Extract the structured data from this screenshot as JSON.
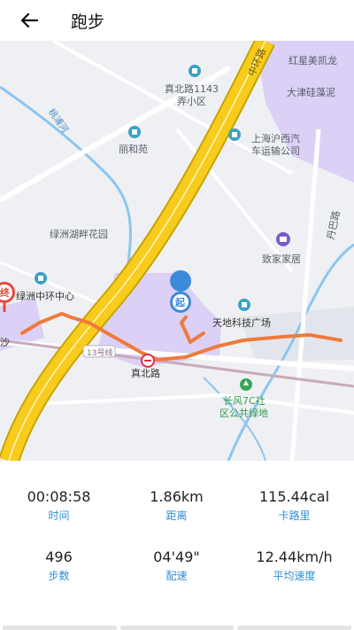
{
  "header": {
    "title": "跑步"
  },
  "map": {
    "labels": {
      "zhonghuan_road": "中环路",
      "hongxing": "红星美凯龙",
      "dajin": "大津硅藻泥",
      "zhenbei_poi": "真北路1143弄小区",
      "zhenbei_poi_line1": "真北路1143",
      "zhenbei_poi_line2": "弄小区",
      "lihe": "丽和苑",
      "shanghai_hx": "上海沪西汽车运输公司",
      "shanghai_hx_line1": "上海沪西汽",
      "shanghai_hx_line2": "车运输公司",
      "creek": "桃浦河",
      "lvzhou_hu": "绿洲湖畔花园",
      "dantian": "丹巴路",
      "zhijia": "致家家居",
      "lvzhou_zx": "绿洲中环中心",
      "tiandi": "天地科技广场",
      "sha": "沙",
      "road_south": "真北路",
      "metro": "13号线",
      "zhenbei_station": "真北路",
      "changfeng": "长风7C社区公共绿地",
      "changfeng_line1": "长风7C社",
      "changfeng_line2": "区公共绿地",
      "start_marker": "起",
      "end_marker": "终"
    },
    "colors": {
      "route": "#f07a3c",
      "expressway": "#f5c518",
      "park": "#d9ccf5",
      "water": "#8ec5f0"
    }
  },
  "stats": [
    {
      "value": "00:08:58",
      "label": "时间"
    },
    {
      "value": "1.86km",
      "label": "距离"
    },
    {
      "value": "115.44cal",
      "label": "卡路里"
    },
    {
      "value": "496",
      "label": "步数"
    },
    {
      "value": "04'49\"",
      "label": "配速"
    },
    {
      "value": "12.44km/h",
      "label": "平均速度"
    }
  ],
  "icons": {
    "back": "arrow-left-icon",
    "poi": "poi-pin-icon",
    "metro": "metro-icon",
    "park": "park-icon",
    "shop": "shop-icon"
  }
}
